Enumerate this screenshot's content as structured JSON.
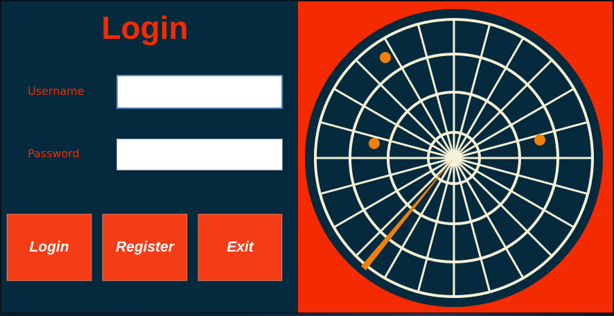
{
  "title": "Login",
  "form": {
    "username_label": "Username",
    "username_value": "",
    "password_label": "Password",
    "password_value": ""
  },
  "buttons": {
    "login": "Login",
    "register": "Register",
    "exit": "Exit"
  },
  "colors": {
    "accent": "#f42b00",
    "panel": "#052a3d",
    "button": "#f43c16",
    "radar_lines": "#f5f1d6",
    "radar_blip": "#f0800a"
  },
  "radar": {
    "icon": "radar-icon",
    "blip_count": 3
  }
}
